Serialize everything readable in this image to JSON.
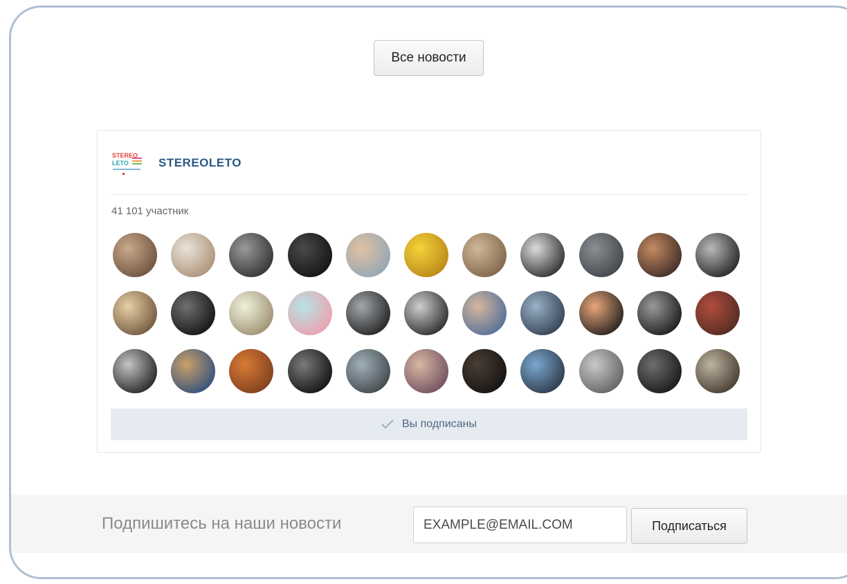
{
  "top_button": {
    "label": "Все новости"
  },
  "widget": {
    "group_name": "STEREOLETO",
    "logo": {
      "icon": "stereoleto-logo",
      "text_top": "STEREO",
      "text_bottom": "LETO"
    },
    "members_count": "41 101 участник",
    "avatars": [
      {
        "colors": [
          "#c9a98b",
          "#6a4e3c"
        ]
      },
      {
        "colors": [
          "#e9e3da",
          "#a98e73"
        ]
      },
      {
        "colors": [
          "#999999",
          "#2e2e2e"
        ]
      },
      {
        "colors": [
          "#4a4a4a",
          "#111111"
        ]
      },
      {
        "colors": [
          "#e2c1a1",
          "#8ea5b7"
        ]
      },
      {
        "colors": [
          "#f4d33a",
          "#b78417"
        ]
      },
      {
        "colors": [
          "#cfb898",
          "#7b6146"
        ]
      },
      {
        "colors": [
          "#dcdcdc",
          "#262626"
        ]
      },
      {
        "colors": [
          "#8a8f93",
          "#3e4246"
        ]
      },
      {
        "colors": [
          "#c58a62",
          "#382924"
        ]
      },
      {
        "colors": [
          "#b9b9b9",
          "#1e1e1e"
        ]
      },
      {
        "colors": [
          "#e6d0a5",
          "#6c5138"
        ]
      },
      {
        "colors": [
          "#707070",
          "#0f0f0f"
        ]
      },
      {
        "colors": [
          "#eef2da",
          "#9b8a6e"
        ]
      },
      {
        "colors": [
          "#b7e3e6",
          "#ef9daa"
        ]
      },
      {
        "colors": [
          "#a3a8ac",
          "#1b1b1b"
        ]
      },
      {
        "colors": [
          "#cfcfcf",
          "#232323"
        ]
      },
      {
        "colors": [
          "#d6b79f",
          "#4d6b97"
        ]
      },
      {
        "colors": [
          "#9ab0c5",
          "#2d3c4d"
        ]
      },
      {
        "colors": [
          "#e8a67a",
          "#1a1a1a"
        ]
      },
      {
        "colors": [
          "#9a9a9a",
          "#151515"
        ]
      },
      {
        "colors": [
          "#b14d3d",
          "#4d2a22"
        ]
      },
      {
        "colors": [
          "#c4c4c4",
          "#1c1c1c"
        ]
      },
      {
        "colors": [
          "#caa06a",
          "#2a4d7d"
        ]
      },
      {
        "colors": [
          "#d97a35",
          "#7a3d1c"
        ]
      },
      {
        "colors": [
          "#7a7a7a",
          "#0d0d0d"
        ]
      },
      {
        "colors": [
          "#a0b0bb",
          "#3d4245"
        ]
      },
      {
        "colors": [
          "#d8b7a4",
          "#6b4b5c"
        ]
      },
      {
        "colors": [
          "#4a3d33",
          "#121212"
        ]
      },
      {
        "colors": [
          "#7aa8d0",
          "#2a3342"
        ]
      },
      {
        "colors": [
          "#c9c9c9",
          "#5d5d5d"
        ]
      },
      {
        "colors": [
          "#6e6e6e",
          "#141414"
        ]
      },
      {
        "colors": [
          "#bdb3a2",
          "#403528"
        ]
      }
    ],
    "subscribed_label": "Вы подписаны",
    "subscribed_icon": "check-icon"
  },
  "footer": {
    "label": "Подпишитесь на наши новости",
    "email_placeholder": "EXAMPLE@EMAIL.COM",
    "subscribe_label": "Подписаться"
  },
  "colors": {
    "frame_border": "#aebfd4",
    "link": "#2a5885",
    "subscribed_bg": "#e5ebf1",
    "footer_bg": "#f5f5f5"
  }
}
